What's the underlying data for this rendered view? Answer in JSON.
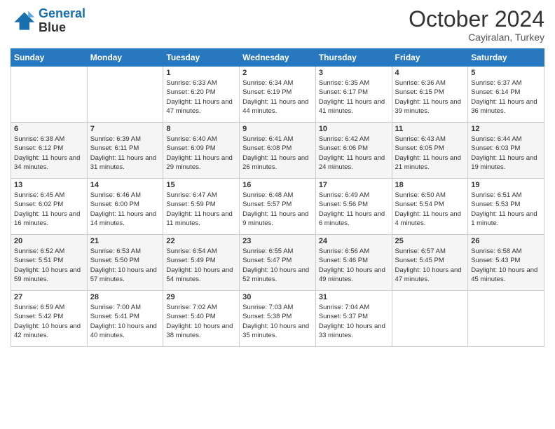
{
  "header": {
    "logo_line1": "General",
    "logo_line2": "Blue",
    "month": "October 2024",
    "location": "Cayiralan, Turkey"
  },
  "days_of_week": [
    "Sunday",
    "Monday",
    "Tuesday",
    "Wednesday",
    "Thursday",
    "Friday",
    "Saturday"
  ],
  "weeks": [
    [
      {
        "day": "",
        "sunrise": "",
        "sunset": "",
        "daylight": ""
      },
      {
        "day": "",
        "sunrise": "",
        "sunset": "",
        "daylight": ""
      },
      {
        "day": "1",
        "sunrise": "Sunrise: 6:33 AM",
        "sunset": "Sunset: 6:20 PM",
        "daylight": "Daylight: 11 hours and 47 minutes."
      },
      {
        "day": "2",
        "sunrise": "Sunrise: 6:34 AM",
        "sunset": "Sunset: 6:19 PM",
        "daylight": "Daylight: 11 hours and 44 minutes."
      },
      {
        "day": "3",
        "sunrise": "Sunrise: 6:35 AM",
        "sunset": "Sunset: 6:17 PM",
        "daylight": "Daylight: 11 hours and 41 minutes."
      },
      {
        "day": "4",
        "sunrise": "Sunrise: 6:36 AM",
        "sunset": "Sunset: 6:15 PM",
        "daylight": "Daylight: 11 hours and 39 minutes."
      },
      {
        "day": "5",
        "sunrise": "Sunrise: 6:37 AM",
        "sunset": "Sunset: 6:14 PM",
        "daylight": "Daylight: 11 hours and 36 minutes."
      }
    ],
    [
      {
        "day": "6",
        "sunrise": "Sunrise: 6:38 AM",
        "sunset": "Sunset: 6:12 PM",
        "daylight": "Daylight: 11 hours and 34 minutes."
      },
      {
        "day": "7",
        "sunrise": "Sunrise: 6:39 AM",
        "sunset": "Sunset: 6:11 PM",
        "daylight": "Daylight: 11 hours and 31 minutes."
      },
      {
        "day": "8",
        "sunrise": "Sunrise: 6:40 AM",
        "sunset": "Sunset: 6:09 PM",
        "daylight": "Daylight: 11 hours and 29 minutes."
      },
      {
        "day": "9",
        "sunrise": "Sunrise: 6:41 AM",
        "sunset": "Sunset: 6:08 PM",
        "daylight": "Daylight: 11 hours and 26 minutes."
      },
      {
        "day": "10",
        "sunrise": "Sunrise: 6:42 AM",
        "sunset": "Sunset: 6:06 PM",
        "daylight": "Daylight: 11 hours and 24 minutes."
      },
      {
        "day": "11",
        "sunrise": "Sunrise: 6:43 AM",
        "sunset": "Sunset: 6:05 PM",
        "daylight": "Daylight: 11 hours and 21 minutes."
      },
      {
        "day": "12",
        "sunrise": "Sunrise: 6:44 AM",
        "sunset": "Sunset: 6:03 PM",
        "daylight": "Daylight: 11 hours and 19 minutes."
      }
    ],
    [
      {
        "day": "13",
        "sunrise": "Sunrise: 6:45 AM",
        "sunset": "Sunset: 6:02 PM",
        "daylight": "Daylight: 11 hours and 16 minutes."
      },
      {
        "day": "14",
        "sunrise": "Sunrise: 6:46 AM",
        "sunset": "Sunset: 6:00 PM",
        "daylight": "Daylight: 11 hours and 14 minutes."
      },
      {
        "day": "15",
        "sunrise": "Sunrise: 6:47 AM",
        "sunset": "Sunset: 5:59 PM",
        "daylight": "Daylight: 11 hours and 11 minutes."
      },
      {
        "day": "16",
        "sunrise": "Sunrise: 6:48 AM",
        "sunset": "Sunset: 5:57 PM",
        "daylight": "Daylight: 11 hours and 9 minutes."
      },
      {
        "day": "17",
        "sunrise": "Sunrise: 6:49 AM",
        "sunset": "Sunset: 5:56 PM",
        "daylight": "Daylight: 11 hours and 6 minutes."
      },
      {
        "day": "18",
        "sunrise": "Sunrise: 6:50 AM",
        "sunset": "Sunset: 5:54 PM",
        "daylight": "Daylight: 11 hours and 4 minutes."
      },
      {
        "day": "19",
        "sunrise": "Sunrise: 6:51 AM",
        "sunset": "Sunset: 5:53 PM",
        "daylight": "Daylight: 11 hours and 1 minute."
      }
    ],
    [
      {
        "day": "20",
        "sunrise": "Sunrise: 6:52 AM",
        "sunset": "Sunset: 5:51 PM",
        "daylight": "Daylight: 10 hours and 59 minutes."
      },
      {
        "day": "21",
        "sunrise": "Sunrise: 6:53 AM",
        "sunset": "Sunset: 5:50 PM",
        "daylight": "Daylight: 10 hours and 57 minutes."
      },
      {
        "day": "22",
        "sunrise": "Sunrise: 6:54 AM",
        "sunset": "Sunset: 5:49 PM",
        "daylight": "Daylight: 10 hours and 54 minutes."
      },
      {
        "day": "23",
        "sunrise": "Sunrise: 6:55 AM",
        "sunset": "Sunset: 5:47 PM",
        "daylight": "Daylight: 10 hours and 52 minutes."
      },
      {
        "day": "24",
        "sunrise": "Sunrise: 6:56 AM",
        "sunset": "Sunset: 5:46 PM",
        "daylight": "Daylight: 10 hours and 49 minutes."
      },
      {
        "day": "25",
        "sunrise": "Sunrise: 6:57 AM",
        "sunset": "Sunset: 5:45 PM",
        "daylight": "Daylight: 10 hours and 47 minutes."
      },
      {
        "day": "26",
        "sunrise": "Sunrise: 6:58 AM",
        "sunset": "Sunset: 5:43 PM",
        "daylight": "Daylight: 10 hours and 45 minutes."
      }
    ],
    [
      {
        "day": "27",
        "sunrise": "Sunrise: 6:59 AM",
        "sunset": "Sunset: 5:42 PM",
        "daylight": "Daylight: 10 hours and 42 minutes."
      },
      {
        "day": "28",
        "sunrise": "Sunrise: 7:00 AM",
        "sunset": "Sunset: 5:41 PM",
        "daylight": "Daylight: 10 hours and 40 minutes."
      },
      {
        "day": "29",
        "sunrise": "Sunrise: 7:02 AM",
        "sunset": "Sunset: 5:40 PM",
        "daylight": "Daylight: 10 hours and 38 minutes."
      },
      {
        "day": "30",
        "sunrise": "Sunrise: 7:03 AM",
        "sunset": "Sunset: 5:38 PM",
        "daylight": "Daylight: 10 hours and 35 minutes."
      },
      {
        "day": "31",
        "sunrise": "Sunrise: 7:04 AM",
        "sunset": "Sunset: 5:37 PM",
        "daylight": "Daylight: 10 hours and 33 minutes."
      },
      {
        "day": "",
        "sunrise": "",
        "sunset": "",
        "daylight": ""
      },
      {
        "day": "",
        "sunrise": "",
        "sunset": "",
        "daylight": ""
      }
    ]
  ]
}
